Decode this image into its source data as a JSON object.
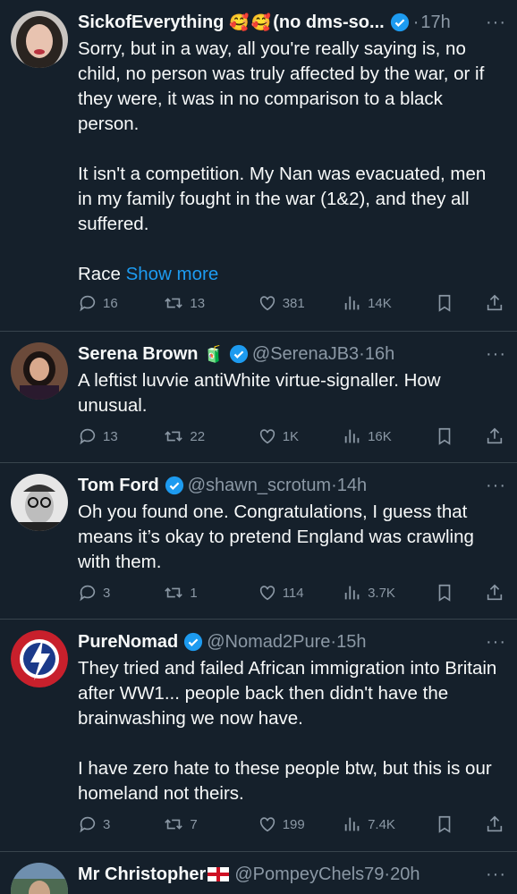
{
  "tweets": [
    {
      "name": "SickofEverything",
      "name_suffix": "(no dms-so...",
      "emojis": [
        "🥰",
        "🥰"
      ],
      "handle": "",
      "time": "17h",
      "text": "Sorry, but in a way, all you're really saying is, no child, no person was truly affected by the war, or if they were, it was in no comparison to a black person.\n\nIt isn't a competition. My Nan was evacuated, men in my family fought in the war (1&2), and they all suffered.\n\nRace ",
      "show_more": "Show more",
      "replies": "16",
      "reposts": "13",
      "likes": "381",
      "views": "14K"
    },
    {
      "name": "Serena Brown",
      "emojis": [
        "🧃"
      ],
      "handle": "@SerenaJB3",
      "time": "16h",
      "text": "A leftist luvvie antiWhite virtue-signaller. How unusual.",
      "replies": "13",
      "reposts": "22",
      "likes": "1K",
      "views": "16K"
    },
    {
      "name": "Tom Ford",
      "handle": "@shawn_scrotum",
      "time": "14h",
      "text": "Oh you found one. Congratulations, I guess that means it’s okay to pretend England was crawling with them.",
      "replies": "3",
      "reposts": "1",
      "likes": "114",
      "views": "3.7K"
    },
    {
      "name": "PureNomad",
      "handle": "@Nomad2Pure",
      "time": "15h",
      "text": "They tried and failed African immigration into Britain after WW1... people back then didn't have the brainwashing we now have.\n\nI have zero hate to these people btw, but this is our homeland not theirs.",
      "replies": "3",
      "reposts": "7",
      "likes": "199",
      "views": "7.4K"
    },
    {
      "name": "Mr Christopher",
      "handle": "@PompeyChels79",
      "time": "20h"
    }
  ],
  "colors": {
    "background": "#15202b",
    "verified": "#1d9bf0",
    "muted": "#8b98a5",
    "link": "#1d9bf0"
  },
  "icons": [
    "reply-icon",
    "repost-icon",
    "like-icon",
    "views-icon",
    "bookmark-icon",
    "share-icon",
    "verified-icon",
    "more-icon"
  ]
}
